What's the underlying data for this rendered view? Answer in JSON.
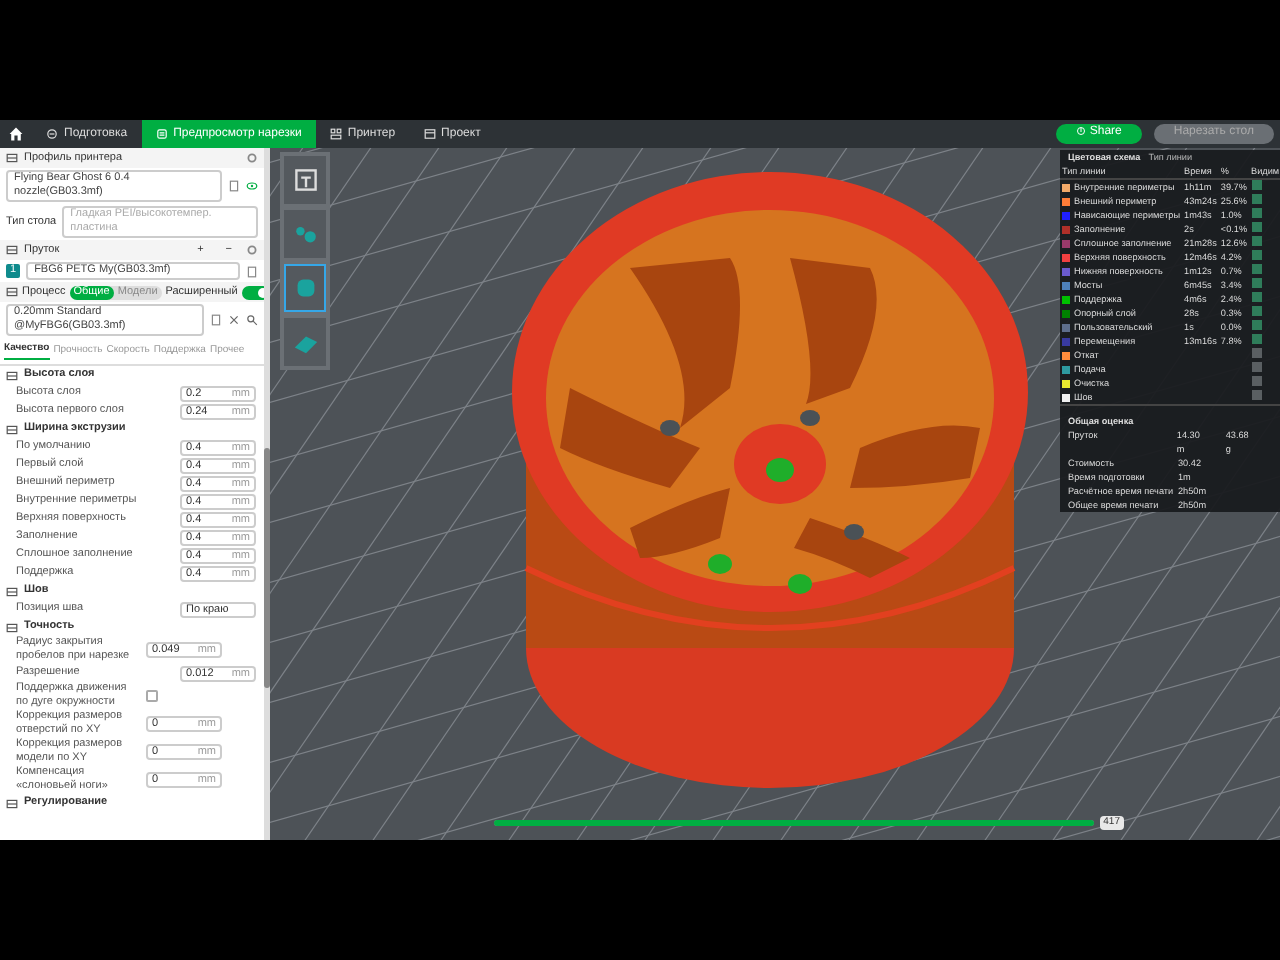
{
  "tabs": [
    {
      "label": "Подготовка",
      "selected": false
    },
    {
      "label": "Предпросмотр нарезки",
      "selected": true
    },
    {
      "label": "Принтер",
      "selected": false
    },
    {
      "label": "Проект",
      "selected": false
    }
  ],
  "top_buttons": [
    {
      "label": "Share",
      "disabled": false
    },
    {
      "label": "Нарезать стол",
      "disabled": true
    }
  ],
  "left_panel": {
    "printer": {
      "title": "Профиль принтера",
      "preset": "Flying Bear Ghost 6 0.4 nozzle(GB03.3mf)",
      "bed_label": "Тип стола",
      "bed_value": "Гладкая PEI/высокотемпер. пластина"
    },
    "filament": {
      "title": "Пруток",
      "add": "+",
      "remove": "−",
      "slot": "1",
      "preset": "FBG6 PETG My(GB03.3mf)"
    },
    "process": {
      "title": "Процесс",
      "scope": [
        {
          "label": "Общие",
          "selected": true
        },
        {
          "label": "Модели",
          "selected": false
        }
      ],
      "advanced_label": "Расширенный",
      "advanced_on": true,
      "preset": "0.20mm Standard @MyFBG6(GB03.3mf)"
    },
    "settings_tabs": [
      {
        "label": "Качество",
        "selected": true
      },
      {
        "label": "Прочность",
        "selected": false
      },
      {
        "label": "Скорость",
        "selected": false
      },
      {
        "label": "Поддержка",
        "selected": false
      },
      {
        "label": "Прочее",
        "selected": false
      }
    ],
    "groups": [
      {
        "title": "Высота слоя",
        "rows": [
          {
            "kind": "number",
            "label": "Высота слоя",
            "value": "0.2",
            "unit": "mm"
          },
          {
            "kind": "number",
            "label": "Высота первого слоя",
            "value": "0.24",
            "unit": "mm"
          }
        ]
      },
      {
        "title": "Ширина экструзии",
        "rows": [
          {
            "kind": "number",
            "label": "По умолчанию",
            "value": "0.4",
            "unit": "mm"
          },
          {
            "kind": "number",
            "label": "Первый слой",
            "value": "0.4",
            "unit": "mm"
          },
          {
            "kind": "number",
            "label": "Внешний периметр",
            "value": "0.4",
            "unit": "mm"
          },
          {
            "kind": "number",
            "label": "Внутренние периметры",
            "value": "0.4",
            "unit": "mm"
          },
          {
            "kind": "number",
            "label": "Верхняя поверхность",
            "value": "0.4",
            "unit": "mm"
          },
          {
            "kind": "number",
            "label": "Заполнение",
            "value": "0.4",
            "unit": "mm"
          },
          {
            "kind": "number",
            "label": "Сплошное заполнение",
            "value": "0.4",
            "unit": "mm"
          },
          {
            "kind": "number",
            "label": "Поддержка",
            "value": "0.4",
            "unit": "mm"
          }
        ]
      },
      {
        "title": "Шов",
        "rows": [
          {
            "kind": "select",
            "label": "Позиция шва",
            "value": "По краю"
          }
        ]
      },
      {
        "title": "Точность",
        "rows": [
          {
            "kind": "number",
            "label": "Радиус закрытия пробелов при нарезке",
            "value": "0.049",
            "unit": "mm"
          },
          {
            "kind": "number",
            "label": "Разрешение",
            "value": "0.012",
            "unit": "mm"
          },
          {
            "kind": "checkbox",
            "label": "Поддержка движения по дуге окружности",
            "checked": false
          },
          {
            "kind": "number",
            "label": "Коррекция размеров отверстий по XY",
            "value": "0",
            "unit": "mm"
          },
          {
            "kind": "number",
            "label": "Коррекция размеров модели по XY",
            "value": "0",
            "unit": "mm"
          },
          {
            "kind": "number",
            "label": "Компенсация «слоновьей ноги»",
            "value": "0",
            "unit": "mm"
          }
        ]
      },
      {
        "title": "Регулирование"
      }
    ]
  },
  "plates": [
    {
      "selected": false
    },
    {
      "selected": true
    },
    {
      "selected": false
    }
  ],
  "legend": {
    "title": "Цветовая схема",
    "scheme": "Тип линии",
    "columns": [
      "Тип линии",
      "Время",
      "%",
      "Видим"
    ],
    "rows": [
      {
        "label": "Внутренние периметры",
        "time": "1h11m",
        "percent": "39.7%",
        "color": "#f0a868",
        "visible": true
      },
      {
        "label": "Внешний периметр",
        "time": "43m24s",
        "percent": "25.6%",
        "color": "#ff7d38",
        "visible": true
      },
      {
        "label": "Нависающие периметры",
        "time": "1m43s",
        "percent": "1.0%",
        "color": "#1f1fff",
        "visible": true
      },
      {
        "label": "Заполнение",
        "time": "2s",
        "percent": "<0.1%",
        "color": "#b03029",
        "visible": true
      },
      {
        "label": "Сплошное заполнение",
        "time": "21m28s",
        "percent": "12.6%",
        "color": "#9a3a6a",
        "visible": true
      },
      {
        "label": "Верхняя поверхность",
        "time": "12m46s",
        "percent": "4.2%",
        "color": "#f04040",
        "visible": true
      },
      {
        "label": "Нижняя поверхность",
        "time": "1m12s",
        "percent": "0.7%",
        "color": "#6a5acd",
        "visible": true
      },
      {
        "label": "Мосты",
        "time": "6m45s",
        "percent": "3.4%",
        "color": "#4d80ba",
        "visible": true
      },
      {
        "label": "Поддержка",
        "time": "4m6s",
        "percent": "2.4%",
        "color": "#00c000",
        "visible": true
      },
      {
        "label": "Опорный слой",
        "time": "28s",
        "percent": "0.3%",
        "color": "#008000",
        "visible": true
      },
      {
        "label": "Пользовательский",
        "time": "1s",
        "percent": "0.0%",
        "color": "#5e6e8c",
        "visible": true
      },
      {
        "label": "Перемещения",
        "time": "13m16s",
        "percent": "7.8%",
        "color": "#383aa0",
        "visible": true
      },
      {
        "label": "Откат",
        "color": "#ff8c3c",
        "visible": false
      },
      {
        "label": "Подача",
        "color": "#2e9aa0",
        "visible": false
      },
      {
        "label": "Очистка",
        "color": "#e8e830",
        "visible": false
      },
      {
        "label": "Шов",
        "color": "#f0f0f0",
        "visible": false
      }
    ]
  },
  "summary": {
    "title": "Общая оценка",
    "rows": [
      {
        "label": "Пруток",
        "values": [
          "14.30 m",
          "43.68 g"
        ]
      },
      {
        "label": "Стоимость",
        "values": [
          "30.42"
        ]
      },
      {
        "label": "Время подготовки",
        "values": [
          "1m"
        ]
      },
      {
        "label": "Расчётное время печати",
        "values": [
          "2h50m"
        ]
      },
      {
        "label": "Общее время печати",
        "values": [
          "2h50m"
        ]
      }
    ]
  },
  "layer_slider": {
    "level": 1,
    "reading": "417"
  }
}
